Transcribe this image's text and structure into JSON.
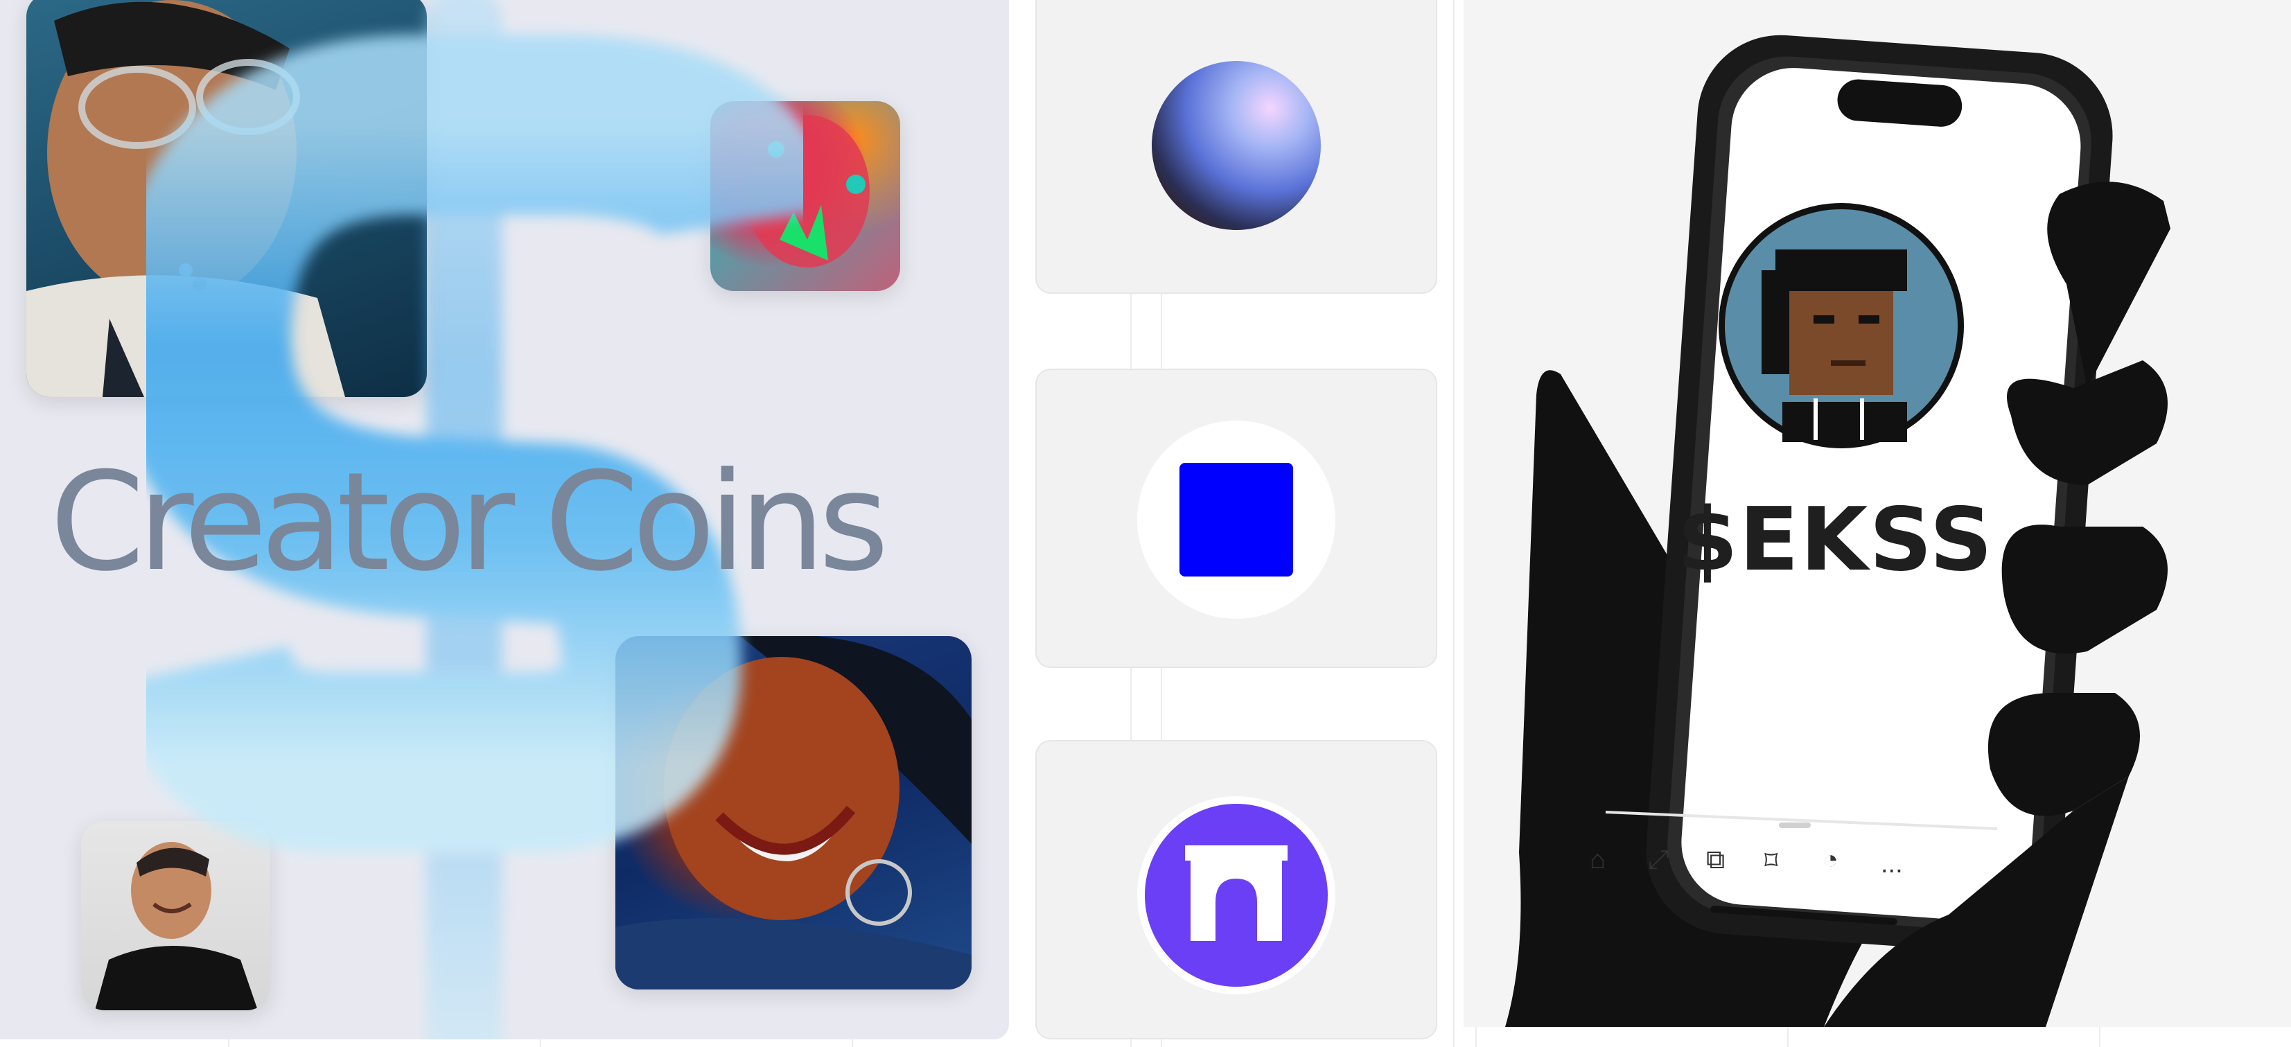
{
  "left_panel": {
    "headline": "Creator Coins",
    "dollar_color": "#3fa9ee"
  },
  "middle_column": {
    "cards": [
      {
        "icon": "sphere-icon",
        "accent": "#6f8ff0"
      },
      {
        "icon": "blue-square-icon",
        "accent": "#0000ff"
      },
      {
        "icon": "arch-icon",
        "accent": "#6b3ff5"
      }
    ]
  },
  "right_panel": {
    "ticker": "$EKSS",
    "nav_icons": [
      "home-icon",
      "share-icon",
      "copy-icon",
      "bookmark-icon",
      "bell-icon",
      "more-icon"
    ],
    "more_label": "..."
  }
}
